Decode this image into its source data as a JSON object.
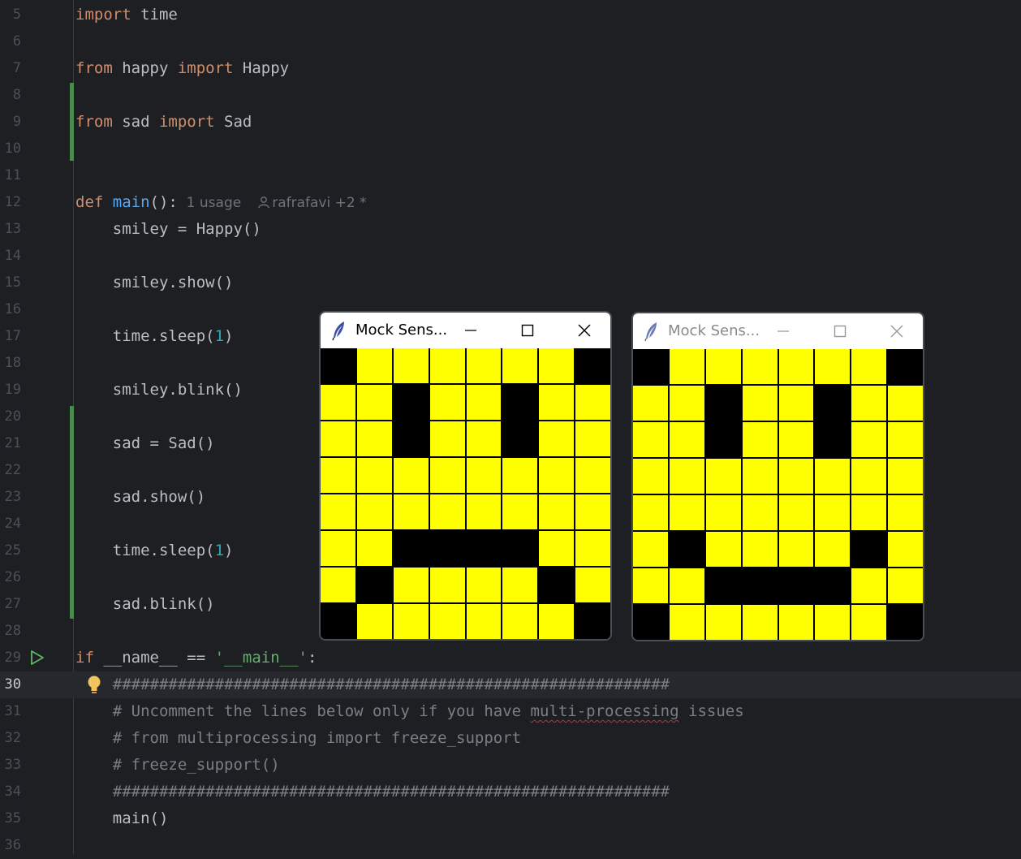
{
  "editor": {
    "lines": [
      {
        "n": "5",
        "tokens": [
          {
            "t": "import",
            "c": "kw"
          },
          {
            "t": " time",
            "c": ""
          }
        ]
      },
      {
        "n": "6",
        "tokens": []
      },
      {
        "n": "7",
        "tokens": [
          {
            "t": "from",
            "c": "kw"
          },
          {
            "t": " happy ",
            "c": ""
          },
          {
            "t": "import",
            "c": "kw"
          },
          {
            "t": " Happy",
            "c": ""
          }
        ]
      },
      {
        "n": "8",
        "tokens": []
      },
      {
        "n": "9",
        "tokens": [
          {
            "t": "from",
            "c": "kw"
          },
          {
            "t": " sad ",
            "c": ""
          },
          {
            "t": "import",
            "c": "kw"
          },
          {
            "t": " Sad",
            "c": ""
          }
        ]
      },
      {
        "n": "10",
        "tokens": []
      },
      {
        "n": "11",
        "tokens": []
      },
      {
        "n": "12",
        "tokens": [
          {
            "t": "def",
            "c": "kw"
          },
          {
            "t": " ",
            "c": ""
          },
          {
            "t": "main",
            "c": "fn"
          },
          {
            "t": "():",
            "c": ""
          }
        ]
      },
      {
        "n": "13",
        "tokens": [
          {
            "t": "    smiley = Happy()",
            "c": ""
          }
        ]
      },
      {
        "n": "14",
        "tokens": []
      },
      {
        "n": "15",
        "tokens": [
          {
            "t": "    smiley.show()",
            "c": ""
          }
        ]
      },
      {
        "n": "16",
        "tokens": []
      },
      {
        "n": "17",
        "tokens": [
          {
            "t": "    time.sleep(",
            "c": ""
          },
          {
            "t": "1",
            "c": "num"
          },
          {
            "t": ")",
            "c": ""
          }
        ]
      },
      {
        "n": "18",
        "tokens": []
      },
      {
        "n": "19",
        "tokens": [
          {
            "t": "    smiley.blink()",
            "c": ""
          }
        ]
      },
      {
        "n": "20",
        "tokens": []
      },
      {
        "n": "21",
        "tokens": [
          {
            "t": "    sad = Sad()",
            "c": ""
          }
        ]
      },
      {
        "n": "22",
        "tokens": []
      },
      {
        "n": "23",
        "tokens": [
          {
            "t": "    sad.show()",
            "c": ""
          }
        ]
      },
      {
        "n": "24",
        "tokens": []
      },
      {
        "n": "25",
        "tokens": [
          {
            "t": "    time.sleep(",
            "c": ""
          },
          {
            "t": "1",
            "c": "num"
          },
          {
            "t": ")",
            "c": ""
          }
        ]
      },
      {
        "n": "26",
        "tokens": []
      },
      {
        "n": "27",
        "tokens": [
          {
            "t": "    sad.blink()",
            "c": ""
          }
        ]
      },
      {
        "n": "28",
        "tokens": []
      },
      {
        "n": "29",
        "tokens": [
          {
            "t": "if",
            "c": "kw"
          },
          {
            "t": " __name__ == ",
            "c": ""
          },
          {
            "t": "'__main__'",
            "c": "str"
          },
          {
            "t": ":",
            "c": ""
          }
        ]
      },
      {
        "n": "30",
        "tokens": [
          {
            "t": "    ",
            "c": ""
          },
          {
            "t": "############################################################",
            "c": "cm"
          }
        ]
      },
      {
        "n": "31",
        "tokens": [
          {
            "t": "    ",
            "c": ""
          },
          {
            "t": "# Uncomment the lines below only if you have ",
            "c": "cm"
          },
          {
            "t": "multi-processing",
            "c": "cm squiggle"
          },
          {
            "t": " issues",
            "c": "cm"
          }
        ]
      },
      {
        "n": "32",
        "tokens": [
          {
            "t": "    ",
            "c": ""
          },
          {
            "t": "# from multiprocessing import freeze_support",
            "c": "cm"
          }
        ]
      },
      {
        "n": "33",
        "tokens": [
          {
            "t": "    ",
            "c": ""
          },
          {
            "t": "# freeze_support()",
            "c": "cm"
          }
        ]
      },
      {
        "n": "34",
        "tokens": [
          {
            "t": "    ",
            "c": ""
          },
          {
            "t": "############################################################",
            "c": "cm"
          }
        ]
      },
      {
        "n": "35",
        "tokens": [
          {
            "t": "    main()",
            "c": ""
          }
        ]
      },
      {
        "n": "36",
        "tokens": []
      }
    ],
    "current_line": "30",
    "inlay_hint": {
      "usages": "1 usage",
      "author": "rafrafavi +2 *"
    }
  },
  "windows": [
    {
      "title": "Mock Sens...",
      "active": true,
      "grid": [
        [
          0,
          1,
          1,
          1,
          1,
          1,
          1,
          0
        ],
        [
          1,
          1,
          0,
          1,
          1,
          0,
          1,
          1
        ],
        [
          1,
          1,
          0,
          1,
          1,
          0,
          1,
          1
        ],
        [
          1,
          1,
          1,
          1,
          1,
          1,
          1,
          1
        ],
        [
          1,
          1,
          1,
          1,
          1,
          1,
          1,
          1
        ],
        [
          1,
          1,
          0,
          0,
          0,
          0,
          1,
          1
        ],
        [
          1,
          0,
          1,
          1,
          1,
          1,
          0,
          1
        ],
        [
          0,
          1,
          1,
          1,
          1,
          1,
          1,
          0
        ]
      ]
    },
    {
      "title": "Mock Sens...",
      "active": false,
      "grid": [
        [
          0,
          1,
          1,
          1,
          1,
          1,
          1,
          0
        ],
        [
          1,
          1,
          0,
          1,
          1,
          0,
          1,
          1
        ],
        [
          1,
          1,
          0,
          1,
          1,
          0,
          1,
          1
        ],
        [
          1,
          1,
          1,
          1,
          1,
          1,
          1,
          1
        ],
        [
          1,
          1,
          1,
          1,
          1,
          1,
          1,
          1
        ],
        [
          1,
          0,
          1,
          1,
          1,
          1,
          0,
          1
        ],
        [
          1,
          1,
          0,
          0,
          0,
          0,
          1,
          1
        ],
        [
          0,
          1,
          1,
          1,
          1,
          1,
          1,
          0
        ]
      ]
    }
  ],
  "colors": {
    "on": "#ffff00",
    "off": "#000000",
    "editor_bg": "#1e1f22"
  },
  "icons": {
    "run": "run-gutter-icon",
    "bulb": "lightbulb-icon",
    "window": "feather-icon"
  }
}
